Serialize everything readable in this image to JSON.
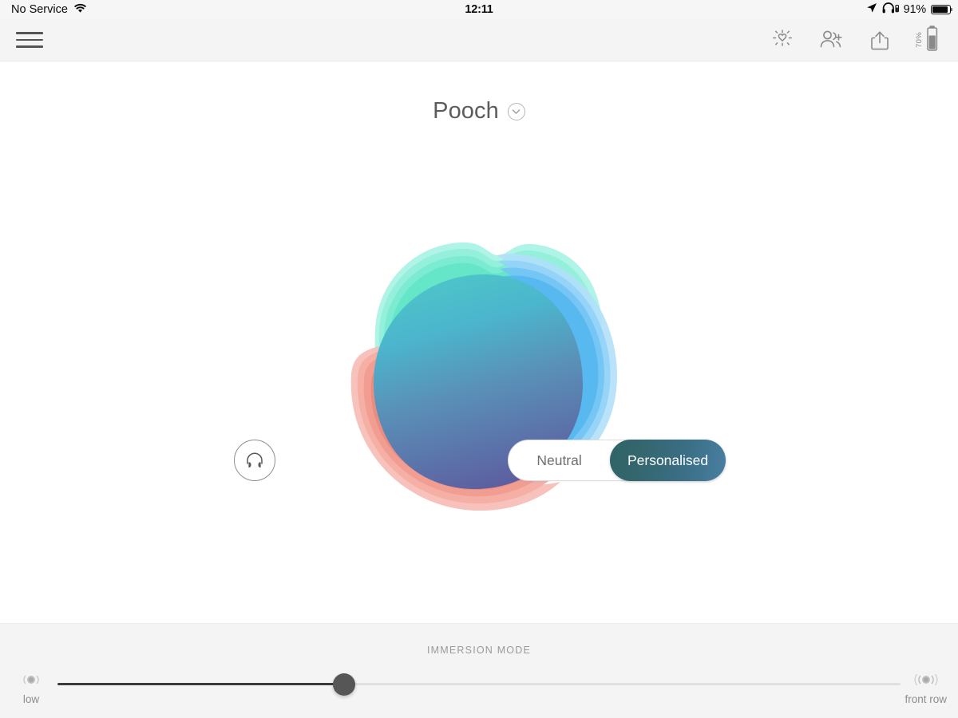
{
  "status_bar": {
    "carrier": "No Service",
    "wifi_icon": "wifi-icon",
    "time": "12:11",
    "location_icon": "location-arrow-icon",
    "headphones_icon": "headphones-battery-icon",
    "battery_percent": "91%",
    "battery_icon": "battery-icon",
    "background": "#f6f6f6"
  },
  "toolbar": {
    "menu_icon": "hamburger-menu-icon",
    "brightness_heart_icon": "brightness-heart-icon",
    "add_person_icon": "add-person-icon",
    "share_icon": "share-icon",
    "device_battery_label": "70%",
    "device_battery_icon": "device-battery-icon",
    "background": "#f4f4f4"
  },
  "header": {
    "profile_name": "Pooch",
    "dropdown_icon": "chevron-down-icon"
  },
  "visual": {
    "blob_name": "hearing-profile-blob",
    "layers": {
      "mint": "#63e6c8",
      "mint_light": "#9af0dd",
      "sky_blue": "#6cc6f2",
      "sky_blue_light": "#a9dcf7",
      "coral": "#f0938a",
      "coral_light": "#f5b4ad",
      "core_top": "#4dc6c9",
      "core_bottom": "#5a5f9b"
    }
  },
  "controls": {
    "headphones_button": "headphones-icon",
    "segmented": {
      "options": [
        "Neutral",
        "Personalised"
      ],
      "selected": "Personalised",
      "selected_index": 1,
      "active_gradient_from": "#2f6468",
      "active_gradient_to": "#4a7fa3"
    }
  },
  "footer": {
    "section_label": "IMMERSION MODE",
    "slider": {
      "min_label": "low",
      "max_label": "front row",
      "min_icon": "sound-low-icon",
      "max_icon": "sound-high-icon",
      "value_percent": 34,
      "thumb_color": "#565656",
      "filled_track_color": "#3a3a3a",
      "empty_track_color": "#e0e0e0"
    },
    "background": "#f4f4f4"
  }
}
